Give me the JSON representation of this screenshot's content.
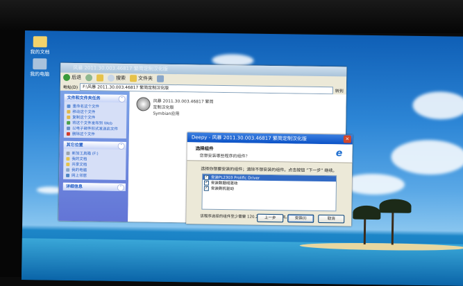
{
  "desktop": {
    "icons": [
      {
        "label": "我的文档",
        "name": "my-documents-icon"
      },
      {
        "label": "我的电脑",
        "name": "my-computer-icon"
      }
    ]
  },
  "explorer": {
    "title": "风暴 2011.30.003.46817 繁简定制汉化版",
    "toolbar": {
      "back": "后退",
      "search": "搜索",
      "folders": "文件夹"
    },
    "address": {
      "label": "地址(D)",
      "value": "F:\\风暴 2011.30.003.46817 繁简定制汉化版",
      "go": "转到"
    },
    "tasks": {
      "header": "文件和文件夹任务",
      "items": [
        "重命名这个文件",
        "移动这个文件",
        "复制这个文件",
        "将这个文件发布到 Web",
        "以电子邮件形式发送此文件",
        "删除这个文件"
      ]
    },
    "places": {
      "header": "其它位置",
      "items": [
        "新加工具箱 (F:)",
        "我的文档",
        "共享文档",
        "我的电脑",
        "网上邻居"
      ]
    },
    "details": {
      "header": "详细信息"
    },
    "file": {
      "name": "风暴 2011.30.003.46817 繁简定制汉化版",
      "type": "Symbian应用"
    }
  },
  "dialog": {
    "title": "Deepy - 风暴 2011.30.003.46817 繁简定制汉化版",
    "heading": "选择组件",
    "subheading": "您想安装哪些程序的组件？",
    "instruction": "选择你想要安装的组件；清除不想安装的组件。点击按钮 “下一步” 继续。",
    "components": [
      {
        "label": "安装PL2303 Prolific Driver",
        "checked": true,
        "selected": true
      },
      {
        "label": "安装数据线驱动",
        "checked": true,
        "selected": false
      },
      {
        "label": "安装刷机驱动",
        "checked": true,
        "selected": false
      }
    ],
    "space_required": "该程序选择的组件至少需要 120.2 MB 的磁盘空间。",
    "buttons": {
      "back": "上一步",
      "install": "安装(I)",
      "cancel": "取消"
    }
  }
}
